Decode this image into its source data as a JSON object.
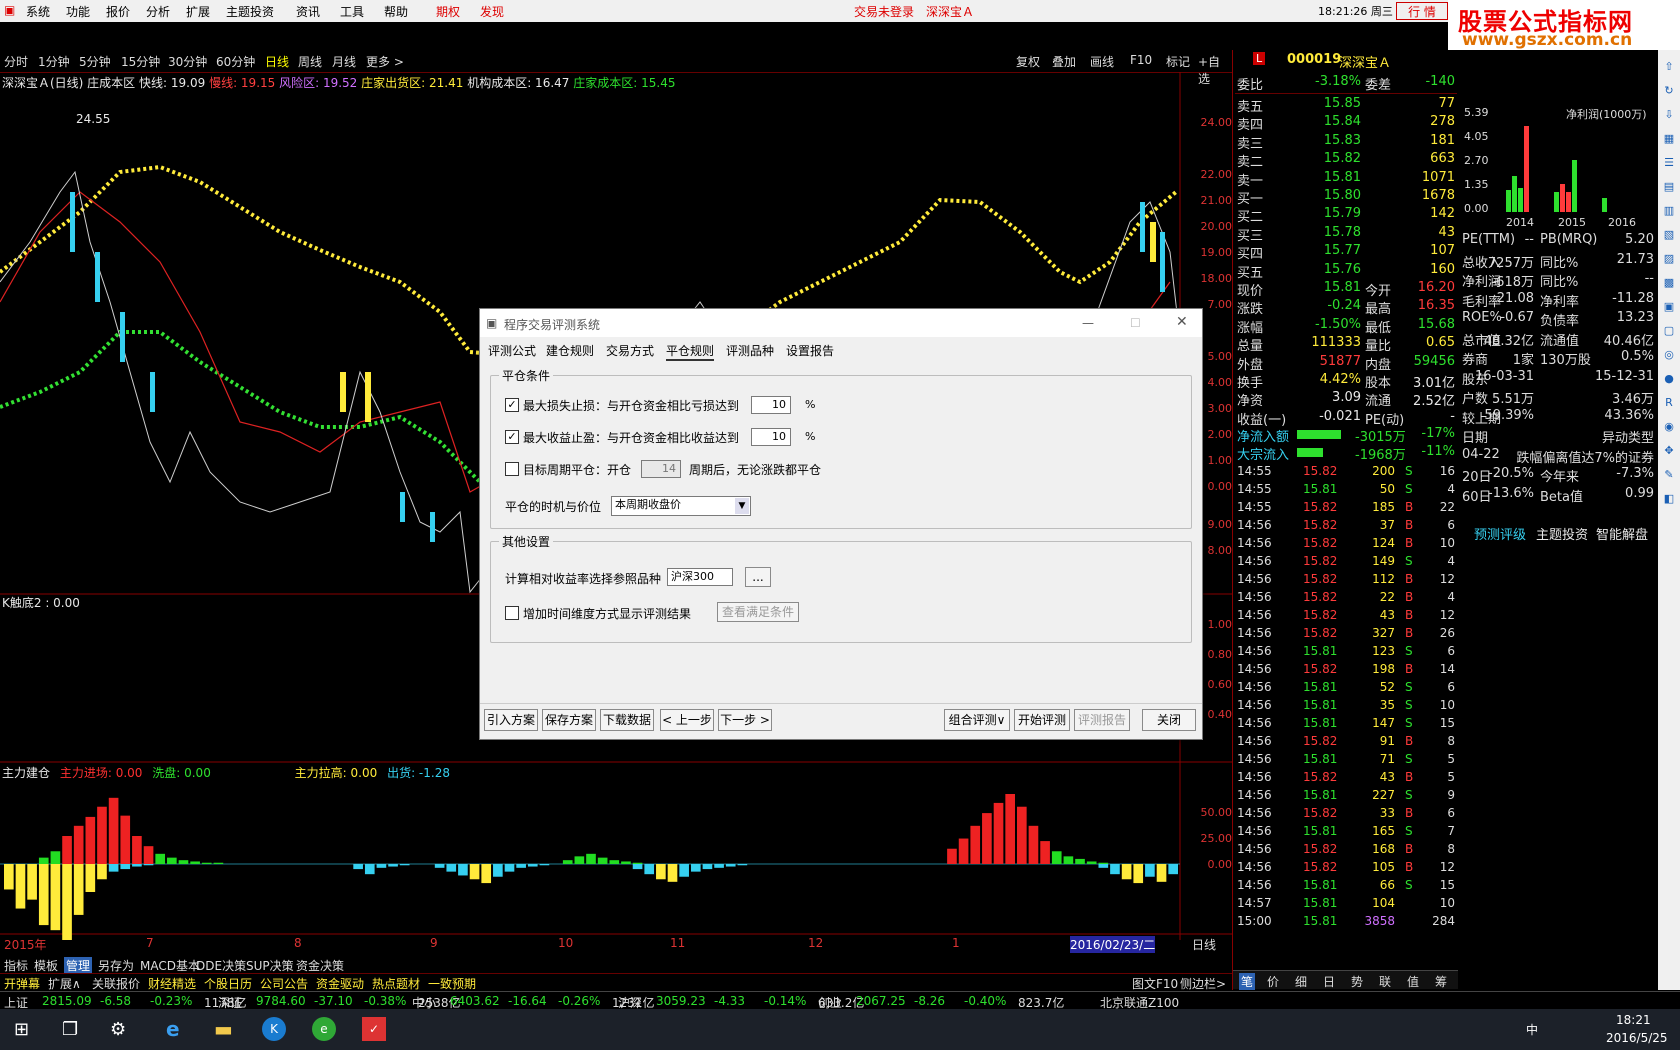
{
  "menubar": {
    "items": [
      "系统",
      "功能",
      "报价",
      "分析",
      "扩展",
      "主题投资",
      "资讯",
      "工具",
      "帮助"
    ],
    "special": [
      "期权",
      "发现"
    ],
    "status": "交易未登录",
    "stock": "深深宝Ａ",
    "clock": "18:21:26 周三",
    "trade_buttons": [
      "行",
      "情"
    ]
  },
  "logo": {
    "line1": "股票公式指标网",
    "line2": "www.gszx.com.cn"
  },
  "periods": [
    "分时",
    "1分钟",
    "5分钟",
    "15分钟",
    "30分钟",
    "60分钟",
    "日线",
    "周线",
    "月线",
    "更多 >"
  ],
  "selected_period": "日线",
  "chart_tools": [
    "复权",
    "叠加",
    "画线",
    "F10",
    "标记",
    "+自选"
  ],
  "main_indicator": {
    "name": "深深宝Ａ(日线) 庄成本区",
    "fast": "快线: 19.09",
    "slow": "慢线: 19.15",
    "risk": "风险区: 19.52",
    "out": "庄家出货区: 21.41",
    "inst": "机构成本区: 16.47",
    "cost": "庄家成本区: 15.45",
    "high_label": "24.55"
  },
  "price_axis": [
    "24.00",
    "22.00",
    "21.00",
    "20.00",
    "19.00",
    "18.00",
    "7.00",
    "5.00",
    "4.00",
    "3.00",
    "2.00",
    "1.00",
    "0.00",
    "9.00",
    "8.00"
  ],
  "sub1": {
    "name": "K触底2 : 0.00",
    "axis": [
      "1.00",
      "0.80",
      "0.60",
      "0.40"
    ]
  },
  "sub2": {
    "name": "主力建仓",
    "in": "主力进场: 0.00",
    "wash": "洗盘: 0.00",
    "pull": "主力拉高: 0.00",
    "ship": "出货: -1.28",
    "axis": [
      "50.00",
      "25.00",
      "0.00"
    ]
  },
  "xaxis": {
    "labels": [
      "2015年",
      "7",
      "8",
      "9",
      "10",
      "11",
      "12",
      "1",
      "2016/02/23/二"
    ],
    "right": "日线"
  },
  "chart_data": {
    "type": "bar",
    "title": "主力建仓",
    "series": [
      {
        "name": "主力进场",
        "values": [
          0,
          0,
          0,
          5,
          10,
          22,
          30,
          37,
          45,
          52,
          38,
          22,
          14,
          8,
          5,
          3,
          2,
          1,
          1,
          0,
          0,
          0,
          0,
          0,
          0,
          0,
          0,
          0,
          0,
          0,
          0,
          0,
          0,
          0,
          0,
          0,
          0,
          0,
          0,
          0,
          0,
          0,
          0,
          0,
          0,
          0,
          0,
          0,
          3,
          6,
          8,
          5,
          3,
          2,
          1,
          0,
          0,
          0,
          0,
          0,
          0,
          0,
          0,
          0,
          0,
          0,
          0,
          0,
          0,
          0,
          0,
          0,
          0,
          0,
          0,
          0,
          0,
          0,
          0,
          0,
          0,
          12,
          20,
          30,
          40,
          48,
          55,
          45,
          30,
          18,
          10,
          6,
          4,
          2,
          1,
          0,
          0,
          0,
          0,
          0,
          0
        ]
      },
      {
        "name": "出货",
        "values": [
          -20,
          -35,
          -28,
          -48,
          -52,
          -60,
          -40,
          -22,
          -12,
          -6,
          -4,
          -2,
          -1,
          0,
          0,
          0,
          0,
          0,
          0,
          0,
          0,
          0,
          0,
          0,
          0,
          0,
          0,
          0,
          0,
          0,
          -4,
          -8,
          -3,
          -2,
          -1,
          0,
          0,
          -3,
          -6,
          -9,
          -12,
          -15,
          -10,
          -6,
          -3,
          -2,
          -1,
          0,
          0,
          0,
          0,
          0,
          0,
          0,
          -4,
          -8,
          -12,
          -14,
          -10,
          -6,
          -4,
          -3,
          -2,
          -1,
          0,
          0,
          0,
          0,
          0,
          0,
          0,
          0,
          0,
          0,
          0,
          0,
          0,
          0,
          0,
          0,
          0,
          0,
          0,
          0,
          0,
          0,
          0,
          0,
          0,
          0,
          0,
          0,
          0,
          0,
          -3,
          -8,
          -12,
          -15,
          -10,
          -14,
          -8,
          -4
        ]
      }
    ],
    "ylim": [
      -60,
      55
    ]
  },
  "quote": {
    "code": "000019",
    "name": "深深宝Ａ",
    "weibi": [
      "委比",
      "-3.18%",
      "委差",
      "-140"
    ],
    "asks": [
      [
        "卖五",
        "15.85",
        "77"
      ],
      [
        "卖四",
        "15.84",
        "278"
      ],
      [
        "卖三",
        "15.83",
        "181"
      ],
      [
        "卖二",
        "15.82",
        "663"
      ],
      [
        "卖一",
        "15.81",
        "1071"
      ]
    ],
    "bids": [
      [
        "买一",
        "15.80",
        "1678"
      ],
      [
        "买二",
        "15.79",
        "142"
      ],
      [
        "买三",
        "15.78",
        "43"
      ],
      [
        "买四",
        "15.77",
        "107"
      ],
      [
        "买五",
        "15.76",
        "160"
      ]
    ],
    "stats": [
      [
        "现价",
        "15.81",
        "今开",
        "16.20"
      ],
      [
        "涨跌",
        "-0.24",
        "最高",
        "16.35"
      ],
      [
        "涨幅",
        "-1.50%",
        "最低",
        "15.68"
      ],
      [
        "总量",
        "111333",
        "量比",
        "0.65"
      ],
      [
        "外盘",
        "51877",
        "内盘",
        "59456"
      ],
      [
        "换手",
        "4.42%",
        "股本",
        "3.01亿"
      ],
      [
        "净资",
        "3.09",
        "流通",
        "2.52亿"
      ],
      [
        "收益(一)",
        "-0.021",
        "PE(动)",
        "-"
      ]
    ],
    "flows": [
      [
        "净流入额",
        "-3015万",
        "-17%"
      ],
      [
        "大宗流入",
        "-1968万",
        "-11%"
      ]
    ]
  },
  "ticks": [
    [
      "14:55",
      "15.82",
      "200",
      "S",
      "16"
    ],
    [
      "14:55",
      "15.81",
      "50",
      "S",
      "4"
    ],
    [
      "14:55",
      "15.82",
      "185",
      "B",
      "22"
    ],
    [
      "14:56",
      "15.82",
      "37",
      "B",
      "6"
    ],
    [
      "14:56",
      "15.82",
      "124",
      "B",
      "10"
    ],
    [
      "14:56",
      "15.82",
      "149",
      "S",
      "4"
    ],
    [
      "14:56",
      "15.82",
      "112",
      "B",
      "12"
    ],
    [
      "14:56",
      "15.82",
      "22",
      "B",
      "4"
    ],
    [
      "14:56",
      "15.82",
      "43",
      "B",
      "12"
    ],
    [
      "14:56",
      "15.82",
      "327",
      "B",
      "26"
    ],
    [
      "14:56",
      "15.81",
      "123",
      "S",
      "6"
    ],
    [
      "14:56",
      "15.82",
      "198",
      "B",
      "14"
    ],
    [
      "14:56",
      "15.81",
      "52",
      "S",
      "6"
    ],
    [
      "14:56",
      "15.81",
      "35",
      "S",
      "10"
    ],
    [
      "14:56",
      "15.81",
      "147",
      "S",
      "15"
    ],
    [
      "14:56",
      "15.82",
      "91",
      "B",
      "8"
    ],
    [
      "14:56",
      "15.81",
      "71",
      "S",
      "5"
    ],
    [
      "14:56",
      "15.82",
      "43",
      "B",
      "5"
    ],
    [
      "14:56",
      "15.81",
      "227",
      "S",
      "9"
    ],
    [
      "14:56",
      "15.82",
      "33",
      "B",
      "6"
    ],
    [
      "14:56",
      "15.81",
      "165",
      "S",
      "7"
    ],
    [
      "14:56",
      "15.82",
      "168",
      "B",
      "8"
    ],
    [
      "14:56",
      "15.82",
      "105",
      "B",
      "12"
    ],
    [
      "14:56",
      "15.81",
      "66",
      "S",
      "15"
    ],
    [
      "14:57",
      "15.81",
      "104",
      "",
      "10"
    ],
    [
      "15:00",
      "15.81",
      "3858",
      "",
      "284"
    ]
  ],
  "right_tabs": [
    "笔",
    "价",
    "细",
    "日",
    "势",
    "联",
    "值",
    "筹"
  ],
  "finance": {
    "header": "000019 · 深深宝A",
    "chart_title": "净利润(1000万)",
    "yaxis": [
      "5.39",
      "4.05",
      "2.70",
      "1.35",
      "0.00"
    ],
    "years": [
      "2014",
      "2015",
      "2016"
    ],
    "rows": [
      [
        "PE(TTM)",
        "--",
        "PB(MRQ)",
        "5.20"
      ],
      [
        "总收入",
        "7257万",
        "同比%",
        "21.73"
      ],
      [
        "净利润",
        "-618万",
        "同比%",
        "--"
      ],
      [
        "毛利率",
        "21.08",
        "净利率",
        "-11.28"
      ],
      [
        "ROE%",
        "-0.67",
        "负债率",
        "13.23"
      ],
      [
        "总市值",
        "48.32亿",
        "流通值",
        "40.46亿"
      ],
      [
        "券商",
        "1家",
        "130万股",
        "0.5%"
      ],
      [
        "股东",
        "16-03-31",
        "",
        "15-12-31"
      ],
      [
        "户数",
        "5.51万",
        "",
        "3.46万"
      ],
      [
        "较上期",
        "59.39%",
        "",
        "43.36%"
      ],
      [
        "日期",
        "",
        "",
        "异动类型"
      ],
      [
        "04-22",
        "",
        "",
        "跌幅偏离值达7%的证券"
      ],
      [
        "20日",
        "-20.5%",
        "今年来",
        "-7.3%"
      ],
      [
        "60日",
        "-13.6%",
        "Beta值",
        "0.99"
      ]
    ],
    "links": [
      "预测评级",
      "主题投资",
      "智能解盘"
    ]
  },
  "bottom1": [
    "指标",
    "模板",
    "管理",
    "另存为",
    "MACD基本",
    "DDE决策",
    "SUP决策",
    "资金决策"
  ],
  "bottom2": [
    "开弹幕",
    "扩展∧",
    "关联报价",
    "财经精选",
    "个股日历",
    "公司公告",
    "资金驱动",
    "热点题材",
    "一致预期"
  ],
  "bottom_right": [
    "图文F10",
    "侧边栏>"
  ],
  "indices": [
    [
      "上证",
      "2815.09",
      "-6.58",
      "-0.23%",
      "1178亿"
    ],
    [
      "深证",
      "9784.60",
      "-37.10",
      "-0.38%",
      "2538亿"
    ],
    [
      "中小",
      "6403.62",
      "-16.64",
      "-0.26%",
      "1231亿"
    ],
    [
      "沪深",
      "3059.23",
      "-4.33",
      "-0.14%",
      "633.2亿"
    ],
    [
      "创业",
      "2067.25",
      "-8.26",
      "-0.40%",
      "823.7亿"
    ]
  ],
  "index_extra": "北京联通Z100",
  "taskbar": {
    "time": "18:21",
    "date": "2016/5/25",
    "ime": "中"
  },
  "dialog": {
    "title": "程序交易评测系统",
    "tabs": [
      "评测公式",
      "建仓规则",
      "交易方式",
      "平仓规则",
      "评测品种",
      "设置报告"
    ],
    "active_tab": "平仓规则",
    "group1": "平仓条件",
    "stoploss": {
      "label": "最大损失止损：与开仓资金相比亏损达到",
      "value": "10",
      "unit": "%",
      "checked": true
    },
    "takeprofit": {
      "label": "最大收益止盈：与开仓资金相比收益达到",
      "value": "10",
      "unit": "%",
      "checked": true
    },
    "period_close": {
      "label": "目标周期平仓：开仓",
      "value": "14",
      "suffix": "周期后，无论涨跌都平仓",
      "checked": false
    },
    "timing_label": "平仓的时机与价位",
    "timing_value": "本周期收盘价",
    "group2": "其他设置",
    "ref_label": "计算相对收益率选择参照品种",
    "ref_value": "沪深300",
    "ref_btn": "...",
    "time_dim_label": "增加时间维度方式显示评测结果",
    "view_cond": "查看满足条件",
    "buttons": [
      "引入方案",
      "保存方案",
      "下载数据",
      "< 上一步",
      "下一步 >"
    ],
    "right_buttons": [
      "组合评测∨",
      "开始评测",
      "评测报告",
      "关闭"
    ]
  }
}
